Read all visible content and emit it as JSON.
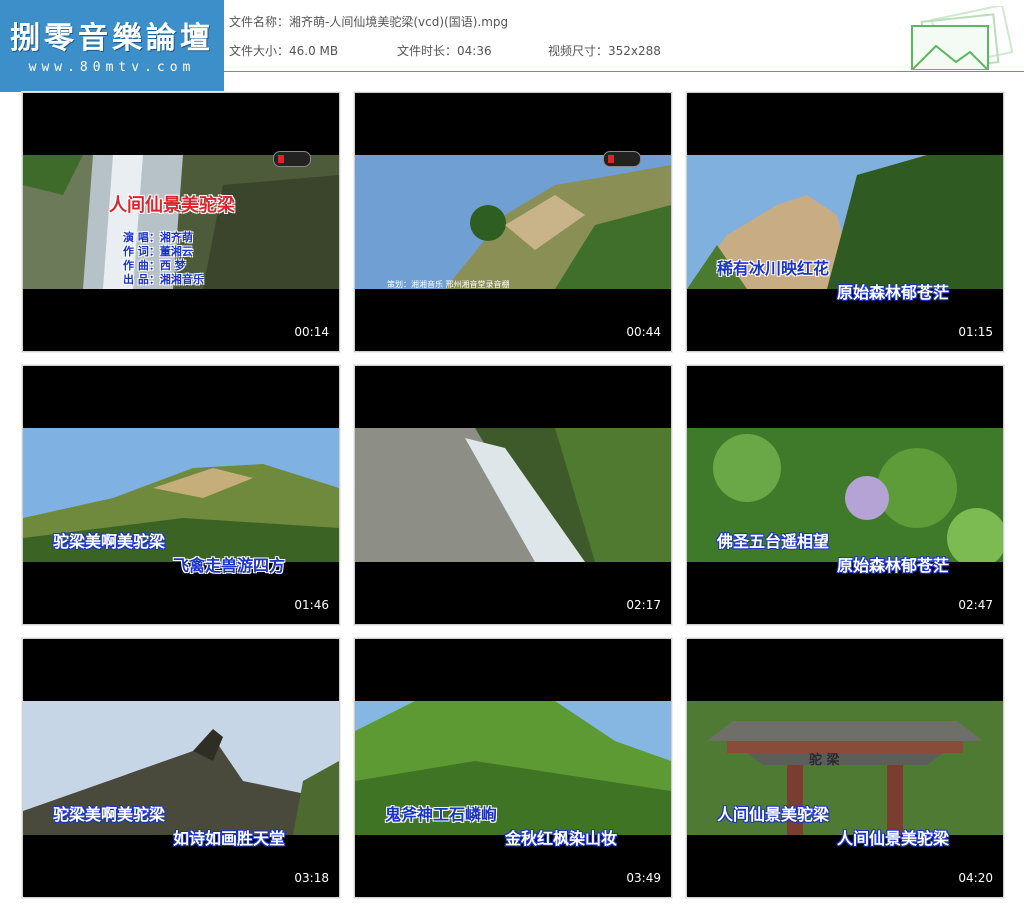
{
  "logo": {
    "title": "捌零音樂論壇",
    "url": "www.80mtv.com"
  },
  "file_info": {
    "name_label": "文件名称：",
    "name": "湘齐萌-人间仙境美驼梁(vcd)(国语).mpg",
    "size_label": "文件大小：",
    "size": "46.0 MB",
    "duration_label": "文件时长：",
    "duration": "04:36",
    "dimension_label": "视频尺寸：",
    "dimension": "352x288"
  },
  "thumbnails": [
    {
      "time": "00:14",
      "title": "人间仙景美驼梁",
      "credits": [
        "演 唱：湘齐萌",
        "作 词：董湘云",
        "作 曲：西 梦",
        "出 品：湘湘音乐"
      ]
    },
    {
      "time": "00:44",
      "caption": "策划：湘湘音乐 邢州湘音堂录音棚"
    },
    {
      "time": "01:15",
      "line1": "稀有冰川映红花",
      "line2": "原始森林郁苍茫"
    },
    {
      "time": "01:46",
      "line1": "驼梁美啊美驼梁",
      "line2": "飞禽走兽游四方"
    },
    {
      "time": "02:17"
    },
    {
      "time": "02:47",
      "line1": "佛圣五台遥相望",
      "line2": "原始森林郁苍茫"
    },
    {
      "time": "03:18",
      "line1": "驼梁美啊美驼梁",
      "line2": "如诗如画胜天堂"
    },
    {
      "time": "03:49",
      "line1": "鬼斧神工石嶙峋",
      "line2": "金秋红枫染山妆"
    },
    {
      "time": "04:20",
      "line1": "人间仙景美驼梁",
      "line2": "人间仙景美驼梁",
      "sign": "驼 梁"
    }
  ]
}
